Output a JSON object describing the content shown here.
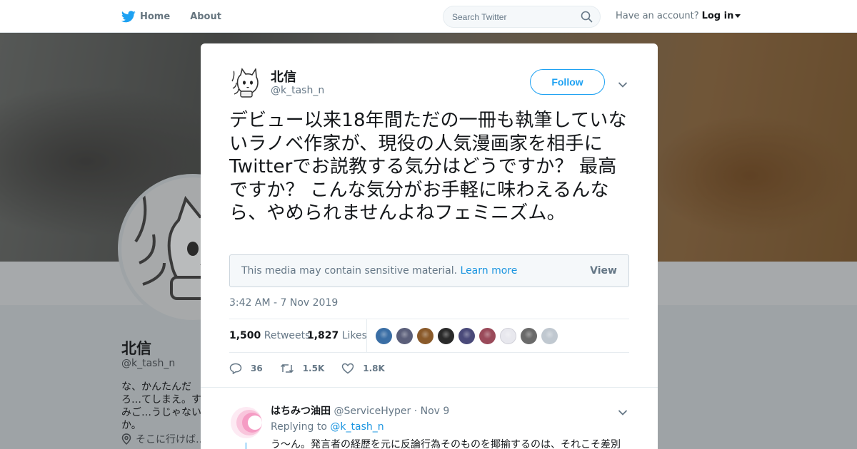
{
  "nav": {
    "home_label": "Home",
    "about_label": "About",
    "search_placeholder": "Search Twitter",
    "account_prompt": "Have an account?",
    "login_label": "Log in"
  },
  "profile": {
    "name": "北信",
    "handle": "@k_tash_n",
    "bio": "な、かんたんだろ…てしまえ。すみご…うじゃないか。",
    "location": "そこに行けば…"
  },
  "tweet": {
    "author_name": "北信",
    "author_handle": "@k_tash_n",
    "follow_label": "Follow",
    "text": "デビュー以来18年間ただの一冊も執筆していないラノベ作家が、現役の人気漫画家を相手にTwitterでお説教する気分はどうですか？ 最高ですか？ こんな気分がお手軽に味わえるんなら、やめられませんよねフェミニズム。",
    "sensitive_notice": "This media may contain sensitive material.",
    "learn_more_label": "Learn more",
    "view_label": "View",
    "timestamp": "3:42 AM - 7 Nov 2019",
    "retweets_count": "1,500",
    "retweets_label": "Retweets",
    "likes_count": "1,827",
    "likes_label": "Likes",
    "reply_action_count": "36",
    "retweet_action_count": "1.5K",
    "like_action_count": "1.8K",
    "liker_avatar_colors": [
      "#3a6ea5",
      "#5b5f7a",
      "#8a5a2a",
      "#2a2a2a",
      "#4a4a7a",
      "#9a4a5a",
      "#e8e8ee",
      "#6a6a6a",
      "#c0c8d0"
    ]
  },
  "reply": {
    "name": "はちみつ油田",
    "handle": "@ServiceHyper",
    "date": "Nov 9",
    "replying_to_label": "Replying to",
    "replying_to_handle": "@k_tash_n",
    "text": "う～ん。発言者の経歴を元に反論行為そのものを揶揄するのは、それこそ差別"
  },
  "colors": {
    "brand": "#1da1f2",
    "link": "#1b95e0",
    "muted_text": "#657786"
  }
}
